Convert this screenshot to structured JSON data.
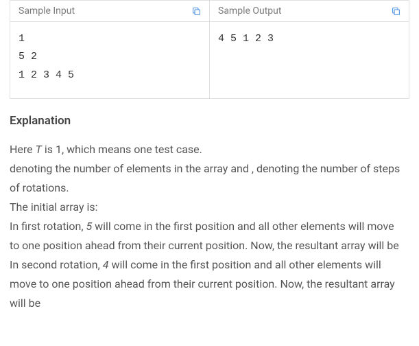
{
  "sample": {
    "inputHeader": "Sample Input",
    "outputHeader": "Sample Output",
    "inputContent": "1\n5 2\n1 2 3 4 5",
    "outputContent": "4 5 1 2 3"
  },
  "explanation": {
    "heading": "Explanation",
    "line1a": "Here ",
    "line1_T": "T",
    "line1b": " is 1, which means one test case.",
    "line2": "denoting the number of elements in the array and , denoting the number of steps of rotations.",
    "line3": "The initial array is:",
    "line4a": "In first rotation, ",
    "line4_5": "5",
    "line4b": " will come in the first position and all other elements will move to one position ahead from their current position. Now, the resultant array will be",
    "line5a": "In second rotation, ",
    "line5_4": "4",
    "line5b": " will come in the first position and all other elements will move to one position ahead from their current position. Now, the resultant array will be"
  }
}
